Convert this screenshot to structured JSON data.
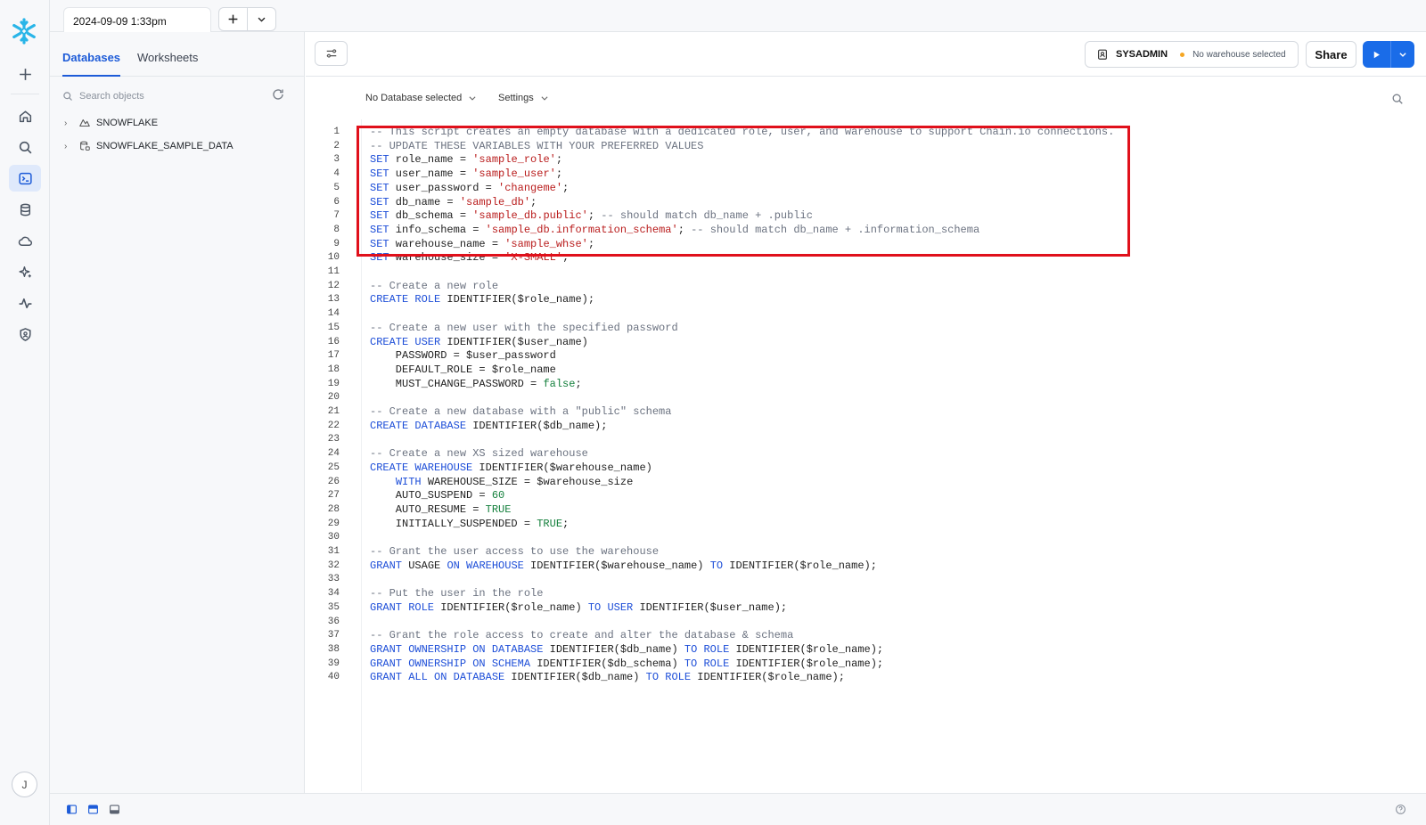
{
  "app": {
    "worksheet_tab": "2024-09-09 1:33pm"
  },
  "sidebar": {
    "tabs": [
      {
        "label": "Databases",
        "active": true
      },
      {
        "label": "Worksheets",
        "active": false
      }
    ],
    "search_placeholder": "Search objects",
    "databases": [
      {
        "name": "SNOWFLAKE",
        "icon": "snowflake-db-icon"
      },
      {
        "name": "SNOWFLAKE_SAMPLE_DATA",
        "icon": "sample-db-icon"
      }
    ]
  },
  "toolbar": {
    "role": "SYSADMIN",
    "warehouse": "No warehouse selected",
    "share_label": "Share"
  },
  "context": {
    "database": "No Database selected",
    "settings": "Settings"
  },
  "colors": {
    "accent": "#1a6ce8",
    "highlight_box": "#e0101b",
    "keyword": "#1d4ed8",
    "string": "#b91c1c",
    "comment": "#6b7280",
    "literal": "#15803d"
  },
  "code_lines": [
    [
      [
        "cm",
        "-- This script creates an empty database with a dedicated role, user, and warehouse to support Chain.io connections."
      ]
    ],
    [
      [
        "cm",
        "-- UPDATE THESE VARIABLES WITH YOUR PREFERRED VALUES"
      ]
    ],
    [
      [
        "kw",
        "SET"
      ],
      [
        "tx",
        " role_name = "
      ],
      [
        "str",
        "'sample_role'"
      ],
      [
        "tx",
        ";"
      ]
    ],
    [
      [
        "kw",
        "SET"
      ],
      [
        "tx",
        " user_name = "
      ],
      [
        "str",
        "'sample_user'"
      ],
      [
        "tx",
        ";"
      ]
    ],
    [
      [
        "kw",
        "SET"
      ],
      [
        "tx",
        " user_password = "
      ],
      [
        "str",
        "'changeme'"
      ],
      [
        "tx",
        ";"
      ]
    ],
    [
      [
        "kw",
        "SET"
      ],
      [
        "tx",
        " db_name = "
      ],
      [
        "str",
        "'sample_db'"
      ],
      [
        "tx",
        ";"
      ]
    ],
    [
      [
        "kw",
        "SET"
      ],
      [
        "tx",
        " db_schema = "
      ],
      [
        "str",
        "'sample_db.public'"
      ],
      [
        "tx",
        "; "
      ],
      [
        "cm",
        "-- should match db_name + .public"
      ]
    ],
    [
      [
        "kw",
        "SET"
      ],
      [
        "tx",
        " info_schema = "
      ],
      [
        "str",
        "'sample_db.information_schema'"
      ],
      [
        "tx",
        "; "
      ],
      [
        "cm",
        "-- should match db_name + .information_schema"
      ]
    ],
    [
      [
        "kw",
        "SET"
      ],
      [
        "tx",
        " warehouse_name = "
      ],
      [
        "str",
        "'sample_whse'"
      ],
      [
        "tx",
        ";"
      ]
    ],
    [
      [
        "kw",
        "SET"
      ],
      [
        "tx",
        " warehouse_size = "
      ],
      [
        "str",
        "'X-SMALL'"
      ],
      [
        "tx",
        ";"
      ]
    ],
    [],
    [
      [
        "cm",
        "-- Create a new role"
      ]
    ],
    [
      [
        "kw",
        "CREATE ROLE"
      ],
      [
        "tx",
        " IDENTIFIER($role_name);"
      ]
    ],
    [],
    [
      [
        "cm",
        "-- Create a new user with the specified password"
      ]
    ],
    [
      [
        "kw",
        "CREATE USER"
      ],
      [
        "tx",
        " IDENTIFIER($user_name)"
      ]
    ],
    [
      [
        "tx",
        "    PASSWORD = $user_password"
      ]
    ],
    [
      [
        "tx",
        "    DEFAULT_ROLE = $role_name"
      ]
    ],
    [
      [
        "tx",
        "    MUST_CHANGE_PASSWORD = "
      ],
      [
        "bool",
        "false"
      ],
      [
        "tx",
        ";"
      ]
    ],
    [],
    [
      [
        "cm",
        "-- Create a new database with a \"public\" schema"
      ]
    ],
    [
      [
        "kw",
        "CREATE DATABASE"
      ],
      [
        "tx",
        " IDENTIFIER($db_name);"
      ]
    ],
    [],
    [
      [
        "cm",
        "-- Create a new XS sized warehouse"
      ]
    ],
    [
      [
        "kw",
        "CREATE WAREHOUSE"
      ],
      [
        "tx",
        " IDENTIFIER($warehouse_name)"
      ]
    ],
    [
      [
        "tx",
        "    "
      ],
      [
        "kw",
        "WITH"
      ],
      [
        "tx",
        " WAREHOUSE_SIZE = $warehouse_size"
      ]
    ],
    [
      [
        "tx",
        "    AUTO_SUSPEND = "
      ],
      [
        "num",
        "60"
      ]
    ],
    [
      [
        "tx",
        "    AUTO_RESUME = "
      ],
      [
        "bool",
        "TRUE"
      ]
    ],
    [
      [
        "tx",
        "    INITIALLY_SUSPENDED = "
      ],
      [
        "bool",
        "TRUE"
      ],
      [
        "tx",
        ";"
      ]
    ],
    [],
    [
      [
        "cm",
        "-- Grant the user access to use the warehouse"
      ]
    ],
    [
      [
        "kw",
        "GRANT"
      ],
      [
        "tx",
        " USAGE "
      ],
      [
        "kw",
        "ON WAREHOUSE"
      ],
      [
        "tx",
        " IDENTIFIER($warehouse_name) "
      ],
      [
        "kw",
        "TO"
      ],
      [
        "tx",
        " IDENTIFIER($role_name);"
      ]
    ],
    [],
    [
      [
        "cm",
        "-- Put the user in the role"
      ]
    ],
    [
      [
        "kw",
        "GRANT ROLE"
      ],
      [
        "tx",
        " IDENTIFIER($role_name) "
      ],
      [
        "kw",
        "TO USER"
      ],
      [
        "tx",
        " IDENTIFIER($user_name);"
      ]
    ],
    [],
    [
      [
        "cm",
        "-- Grant the role access to create and alter the database & schema"
      ]
    ],
    [
      [
        "kw",
        "GRANT OWNERSHIP ON DATABASE"
      ],
      [
        "tx",
        " IDENTIFIER($db_name) "
      ],
      [
        "kw",
        "TO ROLE"
      ],
      [
        "tx",
        " IDENTIFIER($role_name);"
      ]
    ],
    [
      [
        "kw",
        "GRANT OWNERSHIP ON SCHEMA"
      ],
      [
        "tx",
        " IDENTIFIER($db_schema) "
      ],
      [
        "kw",
        "TO ROLE"
      ],
      [
        "tx",
        " IDENTIFIER($role_name);"
      ]
    ],
    [
      [
        "kw",
        "GRANT ALL ON DATABASE"
      ],
      [
        "tx",
        " IDENTIFIER($db_name) "
      ],
      [
        "kw",
        "TO ROLE"
      ],
      [
        "tx",
        " IDENTIFIER($role_name);"
      ]
    ]
  ],
  "user": {
    "avatar_initial": "J"
  }
}
